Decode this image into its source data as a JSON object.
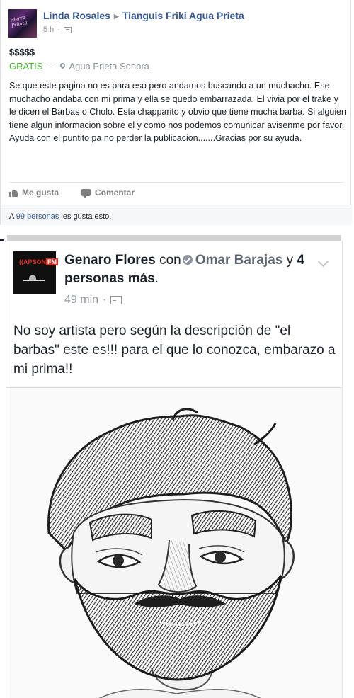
{
  "post1": {
    "author": "Linda Rosales",
    "group": "Tianguis Friki Agua Prieta",
    "avatar_text": "Pierre Piñata",
    "time": "5 h",
    "price": "$$$$$",
    "free_label": "GRATIS",
    "location": "Agua Prieta Sonora",
    "text": "Se que este pagina no es para eso pero andamos buscando a un muchacho. Ese muchacho andaba con mi prima y ella se quedo embarrazada. El vivia por el trake y le dicen el Barbas o Cholo. Esta chapparito y obvio que tiene mucha barba. Si alguien tiene algun informacion sobre el y como nos podemos comunicar avisenme por favor. Ayuda con el puntito pa no perder la publicacion.......Gracias por su ayuda.",
    "like_label": "Me gusta",
    "comment_label": "Comentar",
    "likes_prefix": "A",
    "likes_link": "99 personas",
    "likes_suffix": "les gusta esto."
  },
  "post2": {
    "author": "Genaro Flores",
    "with_word": "con",
    "tagged": "Omar Barajas",
    "and_word": "y",
    "others": "4 personas más",
    "period": ".",
    "avatar_text": "APSON",
    "avatar_badge": "FM",
    "time": "49 min",
    "text": "No soy artista pero según la descripción de \"el barbas\" este es!!! para el que lo conozca, embarazo a mi prima!!"
  },
  "colors": {
    "link_blue": "#365899",
    "free_green": "#42b72a",
    "meta_gray": "#90949c"
  }
}
